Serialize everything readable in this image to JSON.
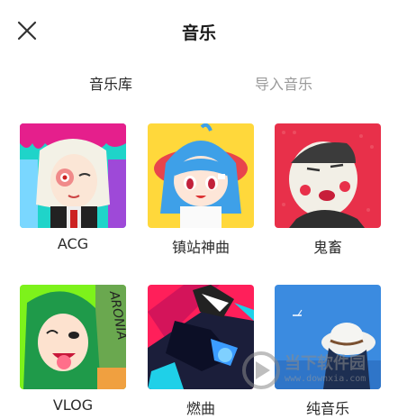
{
  "header": {
    "title": "音乐",
    "close_icon": "close-icon"
  },
  "tabs": [
    {
      "label": "音乐库",
      "active": true
    },
    {
      "label": "导入音乐",
      "active": false
    }
  ],
  "categories": [
    {
      "label": "ACG",
      "art": "anime-girl-art"
    },
    {
      "label": "镇站神曲",
      "art": "chibi-girl-art"
    },
    {
      "label": "鬼畜",
      "art": "meme-face-art"
    },
    {
      "label": "VLOG",
      "art": "green-hair-girl-art"
    },
    {
      "label": "燃曲",
      "art": "action-robot-art"
    },
    {
      "label": "纯音乐",
      "art": "hat-person-art"
    }
  ],
  "watermark": {
    "text": "当下软件园",
    "url": "www.downxia.com"
  },
  "colors": {
    "inactive_tab": "#9a9a9a",
    "text": "#2b2b2b"
  }
}
